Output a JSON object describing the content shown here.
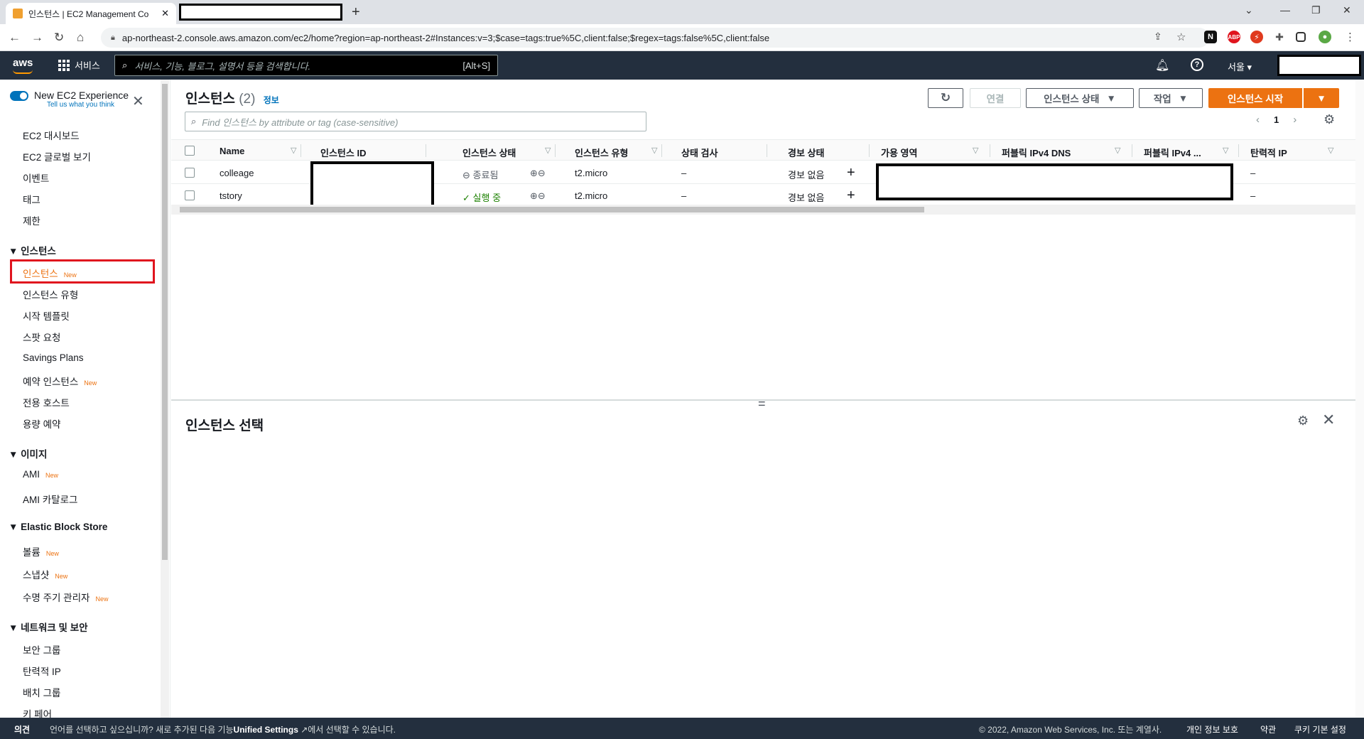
{
  "browser": {
    "tab_title": "인스턴스 | EC2 Management Co",
    "url": "ap-northeast-2.console.aws.amazon.com/ec2/home?region=ap-northeast-2#Instances:v=3;$case=tags:true%5C,client:false;$regex=tags:false%5C,client:false"
  },
  "awsnav": {
    "logo": "aws",
    "services": "서비스",
    "search_placeholder": "서비스, 기능, 블로그, 설명서 등을 검색합니다.",
    "search_shortcut": "[Alt+S]",
    "region": "서울 ▾"
  },
  "sidebar": {
    "experience_title": "New EC2 Experience",
    "experience_sub": "Tell us what you think",
    "top_items": [
      "EC2 대시보드",
      "EC2 글로벌 보기",
      "이벤트",
      "태그",
      "제한"
    ],
    "section_instances": "인스턴스",
    "instances_items": [
      {
        "label": "인스턴스",
        "badge": "New"
      },
      {
        "label": "인스턴스 유형",
        "badge": ""
      },
      {
        "label": "시작 템플릿",
        "badge": ""
      },
      {
        "label": "스팟 요청",
        "badge": ""
      },
      {
        "label": "Savings Plans",
        "badge": ""
      },
      {
        "label": "예약 인스턴스",
        "badge": "New"
      },
      {
        "label": "전용 호스트",
        "badge": ""
      },
      {
        "label": "용량 예약",
        "badge": ""
      }
    ],
    "section_images": "이미지",
    "images_items": [
      {
        "label": "AMI",
        "badge": "New"
      },
      {
        "label": "AMI 카탈로그",
        "badge": ""
      }
    ],
    "section_ebs": "Elastic Block Store",
    "ebs_items": [
      {
        "label": "볼륨",
        "badge": "New"
      },
      {
        "label": "스냅샷",
        "badge": "New"
      },
      {
        "label": "수명 주기 관리자",
        "badge": "New"
      }
    ],
    "section_network": "네트워크 및 보안",
    "network_items": [
      "보안 그룹",
      "탄력적 IP",
      "배치 그룹",
      "키 페어"
    ]
  },
  "main": {
    "title": "인스턴스",
    "count": "(2)",
    "info": "정보",
    "btn_connect": "연결",
    "btn_state": "인스턴스 상태",
    "btn_actions": "작업",
    "btn_launch": "인스턴스 시작",
    "filter_placeholder": "Find 인스턴스 by attribute or tag (case-sensitive)",
    "page": "1",
    "columns": [
      "Name",
      "인스턴스 ID",
      "인스턴스 상태",
      "인스턴스 유형",
      "상태 검사",
      "경보 상태",
      "가용 영역",
      "퍼블릭 IPv4 DNS",
      "퍼블릭 IPv4 ...",
      "탄력적 IP"
    ],
    "rows": [
      {
        "name": "colleage",
        "state": "종료됨",
        "type": "t2.micro",
        "check": "–",
        "alarm": "경보 없음",
        "eip": "–"
      },
      {
        "name": "tstory",
        "state": "실행 중",
        "type": "t2.micro",
        "check": "–",
        "alarm": "경보 없음",
        "eip": "–"
      }
    ],
    "detail_title": "인스턴스 선택"
  },
  "footer": {
    "feedback": "의견",
    "lang_text_a": "언어를 선택하고 싶으십니까? 새로 추가된 다음 기능",
    "lang_link": "Unified Settings",
    "lang_text_b": "에서 선택할 수 있습니다.",
    "copyright": "© 2022, Amazon Web Services, Inc. 또는 계열사.",
    "privacy": "개인 정보 보호",
    "terms": "약관",
    "cookies": "쿠키 기본 설정"
  },
  "colors": {
    "aws_nav": "#232f3e",
    "accent": "#ec7211",
    "link": "#0073bb",
    "running": "#1d8102"
  }
}
